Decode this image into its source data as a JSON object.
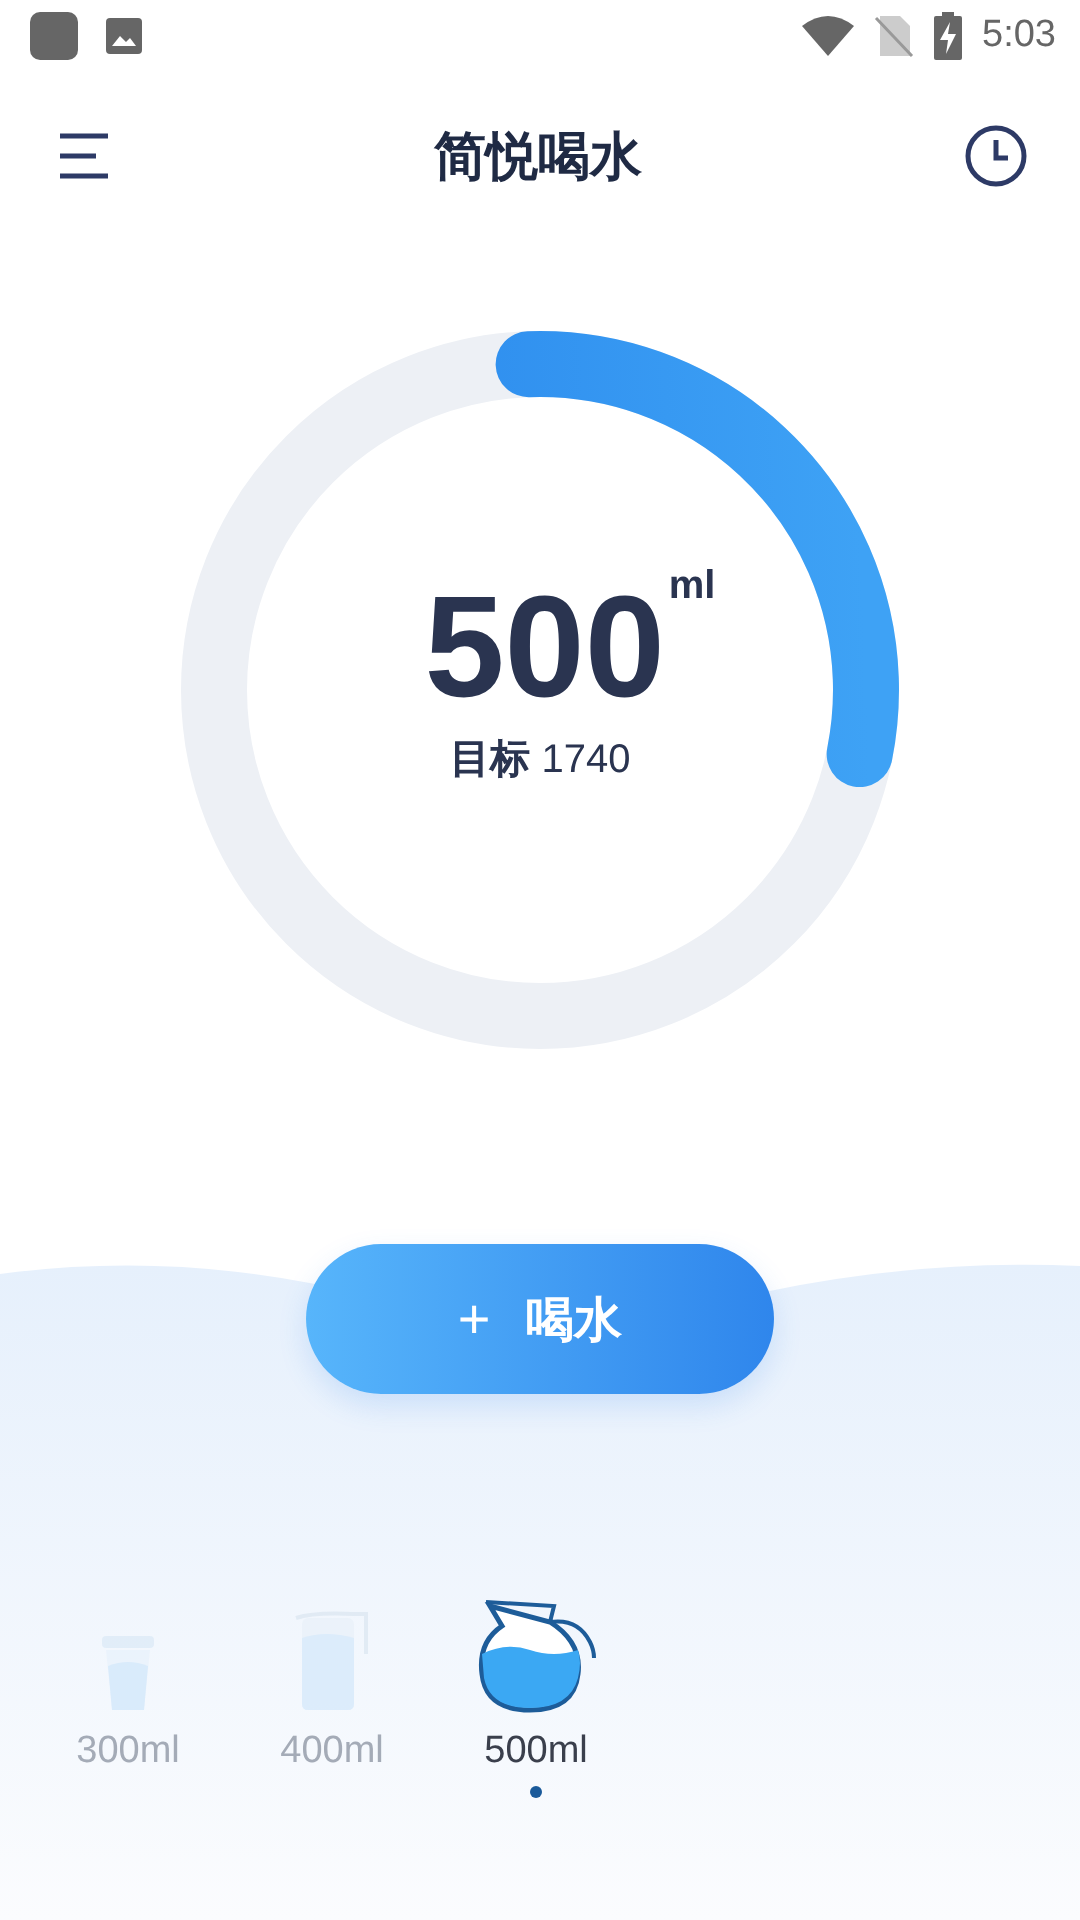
{
  "status_bar": {
    "time": "5:03"
  },
  "header": {
    "title": "简悦喝水"
  },
  "progress": {
    "amount": "500",
    "unit": "ml",
    "goal_label": "目标",
    "goal_value": "1740"
  },
  "drink_button": {
    "icon_text": "+",
    "label": "喝水"
  },
  "cups": [
    {
      "kind": "cup",
      "label": "300ml",
      "selected": false
    },
    {
      "kind": "pitcher",
      "label": "400ml",
      "selected": false
    },
    {
      "kind": "kettle",
      "label": "500ml",
      "selected": true
    }
  ]
}
